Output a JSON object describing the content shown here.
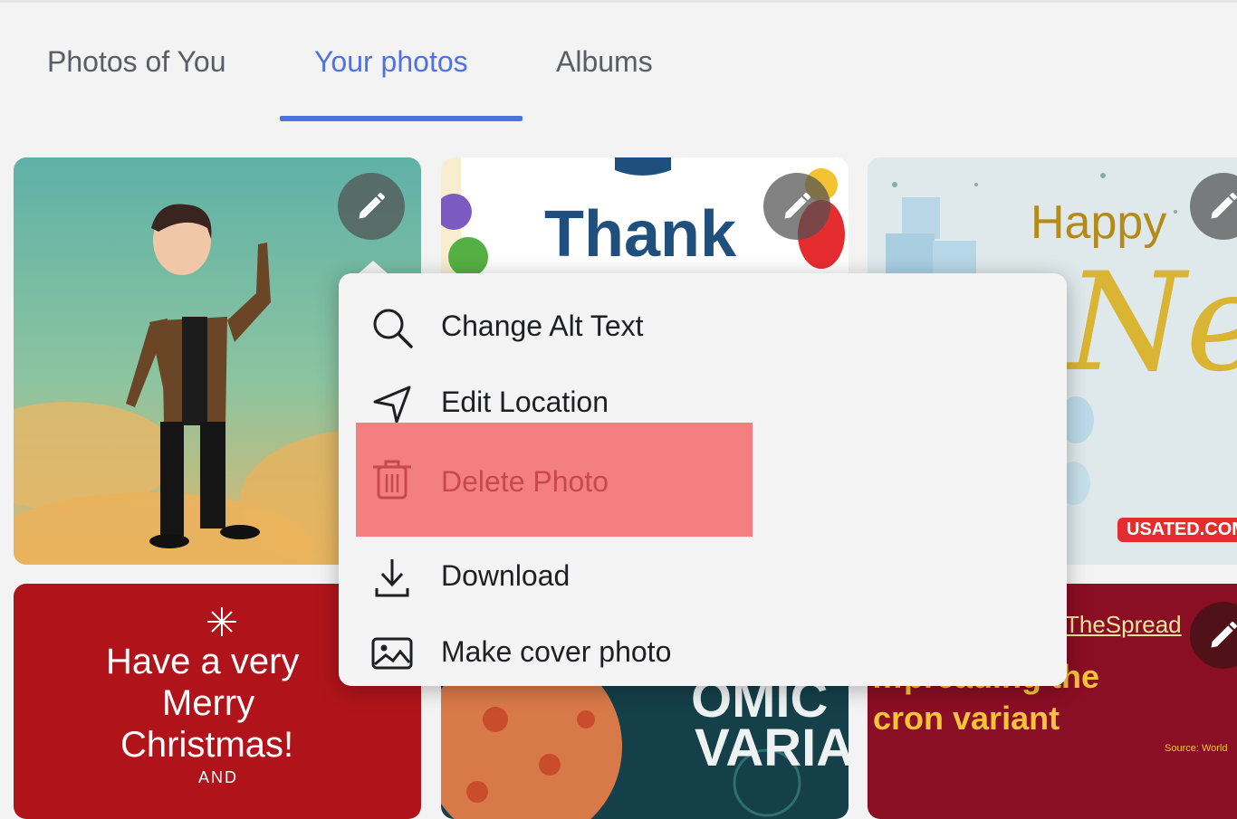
{
  "tabs": [
    {
      "label": "Photos of You",
      "active": false
    },
    {
      "label": "Your photos",
      "active": true
    },
    {
      "label": "Albums",
      "active": false
    }
  ],
  "accent_color": "#4f72e0",
  "photos": [
    {
      "id": "avatar",
      "text": ""
    },
    {
      "id": "thank",
      "text": "Thank"
    },
    {
      "id": "happy-new-year",
      "text": "Happy",
      "script": "New y",
      "badge": "USATED.COM"
    },
    {
      "id": "christmas",
      "lines": [
        "Have a very",
        "Merry",
        "Christmas!",
        "AND"
      ]
    },
    {
      "id": "omicron",
      "lines": [
        "OMIC",
        "VARIA"
      ]
    },
    {
      "id": "spread",
      "handle": "TheSpread",
      "lines": [
        "…preading the",
        "cron variant"
      ],
      "source": "Source: World"
    }
  ],
  "menu": {
    "items": [
      {
        "label": "Change Alt Text",
        "icon": "search-icon"
      },
      {
        "label": "Edit Location",
        "icon": "location-arrow-icon"
      },
      {
        "label": "Delete Photo",
        "icon": "trash-icon",
        "danger": true,
        "highlight_color": "#f47f80"
      },
      {
        "label": "Download",
        "icon": "download-icon"
      },
      {
        "label": "Make cover photo",
        "icon": "image-icon"
      }
    ]
  }
}
